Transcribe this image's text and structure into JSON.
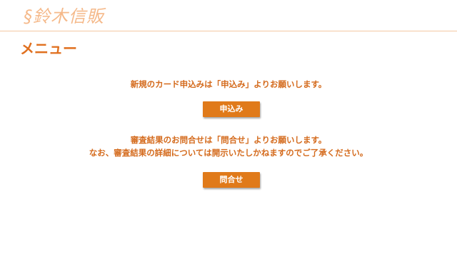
{
  "header": {
    "logo_text": "§鈴木信販"
  },
  "menu": {
    "title": "メニュー"
  },
  "apply_section": {
    "message": "新規のカード申込みは「申込み」よりお願いします。",
    "button_label": "申込み"
  },
  "inquiry_section": {
    "message_line1": "審査結果のお問合せは「問合せ」よりお願いします。",
    "message_line2": "なお、審査結果の詳細については開示いたしかねますのでご了承ください。",
    "button_label": "問合せ"
  },
  "colors": {
    "accent": "#e07a1a",
    "text_accent": "#d46a1c",
    "logo": "#f5b98a",
    "header_rule": "#f3c9a3"
  }
}
